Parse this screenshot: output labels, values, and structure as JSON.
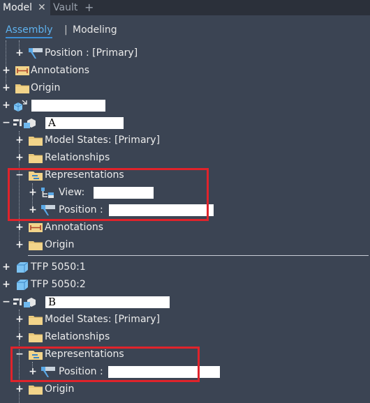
{
  "tabs": [
    {
      "label": "Model",
      "active": true
    },
    {
      "label": "Vault",
      "active": false
    }
  ],
  "tab_close": "✕",
  "tab_add": "+",
  "subtabs": {
    "assembly": "Assembly",
    "separator": "|",
    "modeling": "Modeling"
  },
  "tree": {
    "r0": {
      "label": "Position : [Primary]"
    },
    "r1": {
      "label": "Annotations"
    },
    "r2": {
      "label": "Origin"
    },
    "r3": {
      "label": ""
    },
    "r4": {
      "label": "A"
    },
    "r5": {
      "label": "Model States: [Primary]"
    },
    "r6": {
      "label": "Relationships"
    },
    "r7": {
      "label": "Representations"
    },
    "r8": {
      "label": "View:"
    },
    "r9": {
      "label": "Position :"
    },
    "r10": {
      "label": "Annotations"
    },
    "r11": {
      "label": "Origin"
    },
    "r12": {
      "label": "TFP 5050:1"
    },
    "r13": {
      "label": "TFP 5050:2"
    },
    "r14": {
      "label": "B"
    },
    "r15": {
      "label": "Model States: [Primary]"
    },
    "r16": {
      "label": "Relationships"
    },
    "r17": {
      "label": "Representations"
    },
    "r18": {
      "label": "Position :"
    },
    "r19": {
      "label": "Origin"
    }
  },
  "colors": {
    "background": "#3b4453",
    "accent": "#3c8fd6",
    "highlight": "#e0232b",
    "folder": "#f2d48a"
  }
}
